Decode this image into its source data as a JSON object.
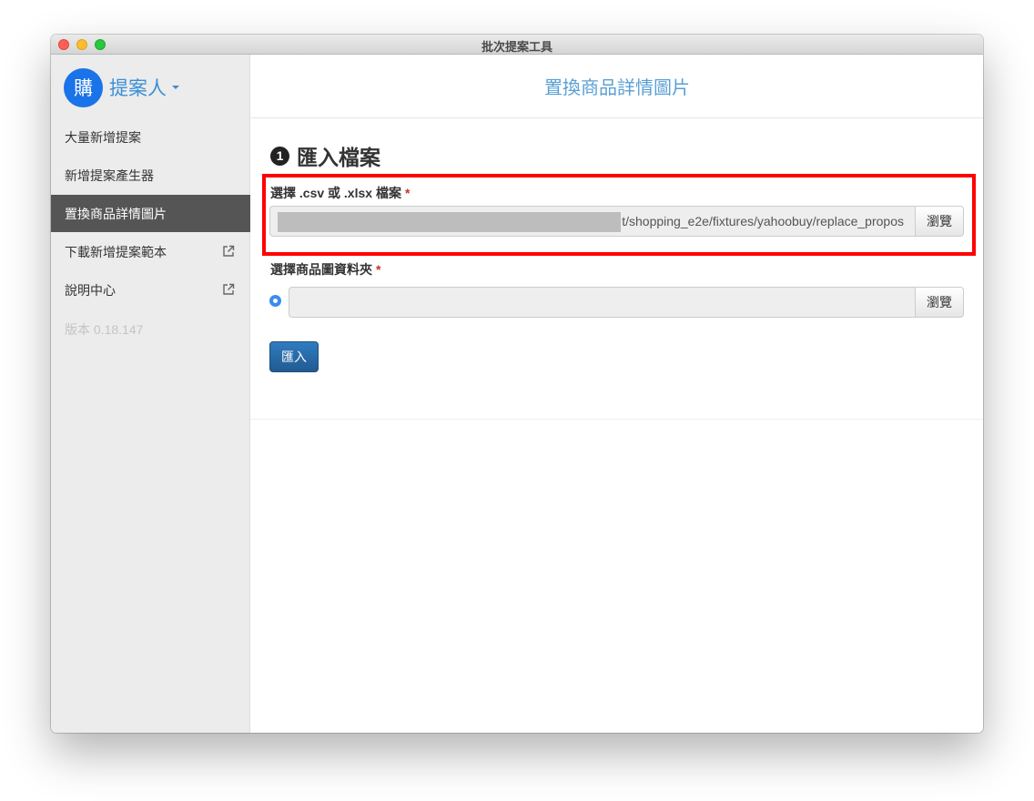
{
  "window": {
    "title": "批次提案工具"
  },
  "sidebar": {
    "avatar_text": "購",
    "user_name": "提案人",
    "items": [
      {
        "label": "大量新增提案",
        "active": false,
        "external": false
      },
      {
        "label": "新增提案產生器",
        "active": false,
        "external": false
      },
      {
        "label": "置換商品詳情圖片",
        "active": true,
        "external": false
      },
      {
        "label": "下載新增提案範本",
        "active": false,
        "external": true
      },
      {
        "label": "說明中心",
        "active": false,
        "external": true
      }
    ],
    "version": "版本 0.18.147"
  },
  "main": {
    "header_title": "置換商品詳情圖片",
    "section": {
      "step": "1",
      "title": "匯入檔案"
    },
    "file_field": {
      "label": "選擇 .csv 或 .xlsx 檔案",
      "required_mark": "*",
      "value": "t/shopping_e2e/fixtures/yahoobuy/replace_propos",
      "browse_label": "瀏覽"
    },
    "folder_field": {
      "label": "選擇商品圖資料夾",
      "required_mark": "*",
      "value": "",
      "browse_label": "瀏覽"
    },
    "import_label": "匯入"
  },
  "colors": {
    "accent": "#3a8fd6",
    "active_nav": "#555555",
    "primary_button": "#225a91",
    "required": "#c9302c",
    "highlight": "#ff0000"
  }
}
